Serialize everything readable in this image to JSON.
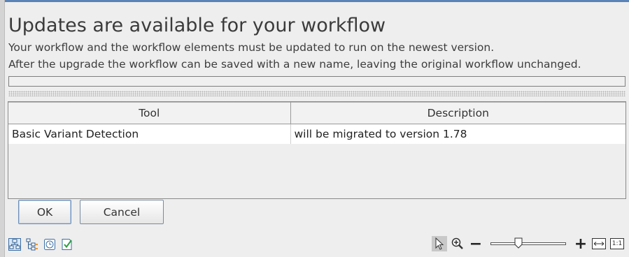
{
  "dialog": {
    "title": "Updates are available for your workflow",
    "message_line1": "Your workflow and the workflow elements must be updated to run on the newest version.",
    "message_line2": "After the upgrade the workflow can be saved with a new name, leaving the original workflow unchanged."
  },
  "progress": {
    "value": 0
  },
  "table": {
    "headers": [
      "Tool",
      "Description"
    ],
    "rows": [
      {
        "tool": "Basic Variant Detection",
        "description": "will be migrated to version 1.78"
      }
    ]
  },
  "buttons": {
    "ok": "OK",
    "cancel": "Cancel"
  },
  "bottom_icons": [
    "workflow-layout-icon",
    "workflow-tree-icon",
    "history-icon",
    "validate-icon"
  ],
  "zoom_controls": {
    "tools": [
      "pointer-icon",
      "zoom-in-tool-icon"
    ],
    "zoom_out": "−",
    "zoom_in": "+",
    "fit_width_icon": "fit-width-icon",
    "actual_size_label": "1:1",
    "slider_level": 0.35
  },
  "colors": {
    "accent": "#5a84b8",
    "selected_tool": "#c8c8c8"
  }
}
